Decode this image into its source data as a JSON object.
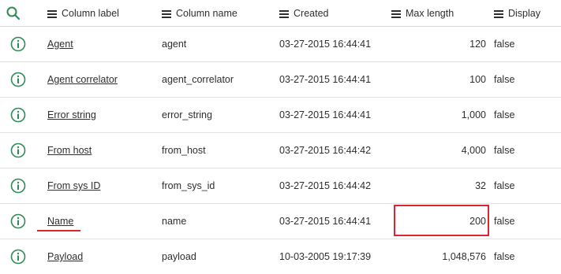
{
  "header": {
    "columns": [
      {
        "label": "Column label"
      },
      {
        "label": "Column name"
      },
      {
        "label": "Created"
      },
      {
        "label": "Max length"
      },
      {
        "label": "Display"
      }
    ]
  },
  "rows": [
    {
      "label": "Agent",
      "name": "agent",
      "created": "03-27-2015 16:44:41",
      "max_length": "120",
      "display": "false"
    },
    {
      "label": "Agent correlator",
      "name": "agent_correlator",
      "created": "03-27-2015 16:44:41",
      "max_length": "100",
      "display": "false"
    },
    {
      "label": "Error string",
      "name": "error_string",
      "created": "03-27-2015 16:44:41",
      "max_length": "1,000",
      "display": "false"
    },
    {
      "label": "From host",
      "name": "from_host",
      "created": "03-27-2015 16:44:42",
      "max_length": "4,000",
      "display": "false"
    },
    {
      "label": "From sys ID",
      "name": "from_sys_id",
      "created": "03-27-2015 16:44:42",
      "max_length": "32",
      "display": "false"
    },
    {
      "label": "Name",
      "name": "name",
      "created": "03-27-2015 16:44:41",
      "max_length": "200",
      "display": "false"
    },
    {
      "label": "Payload",
      "name": "payload",
      "created": "10-03-2005 19:17:39",
      "max_length": "1,048,576",
      "display": "false"
    }
  ],
  "icons": {
    "search": "search-icon",
    "column_menu": "hamburger-menu-icon",
    "row_info": "info-circle-icon"
  },
  "colors": {
    "accent_green": "#2e8a57",
    "highlight_red": "#d9262f"
  }
}
